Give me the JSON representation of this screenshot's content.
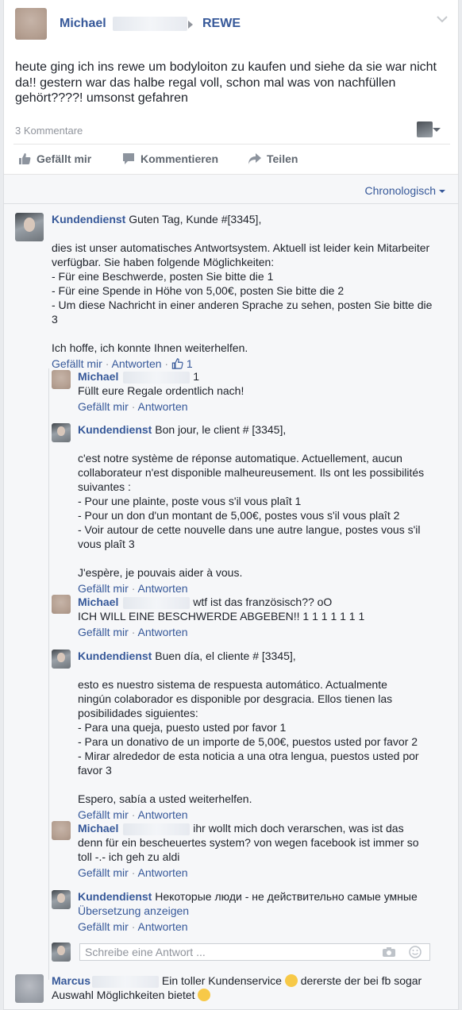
{
  "post": {
    "author": "Michael",
    "target": "REWE",
    "text": "heute ging ich ins rewe um bodyloiton zu kaufen und siehe da sie war nicht da!! gestern war das halbe regal voll, schon mal was von nachfüllen gehört????! umsonst gefahren",
    "comment_count": "3 Kommentare"
  },
  "actions": {
    "like": "Gefällt mir",
    "comment": "Kommentieren",
    "share": "Teilen"
  },
  "sort_label": "Chronologisch",
  "comments": [
    {
      "author": "Kundendienst",
      "lead": "Guten Tag, Kunde #[3345],",
      "lines": [
        "dies ist unser automatisches Antwortsystem. Aktuell ist leider kein Mitarbeiter",
        "verfügbar. Sie haben folgende Möglichkeiten:",
        "- Für eine Beschwerde, posten Sie bitte die 1",
        "- Für eine Spende in Höhe von 5,00€, posten Sie bitte die 2",
        "- Um diese Nachricht in einer anderen Sprache zu sehen, posten Sie bitte die",
        "3"
      ],
      "closing": "Ich hoffe, ich konnte Ihnen weiterhelfen.",
      "like": "Gefällt mir",
      "reply": "Antworten",
      "reactions": "1"
    }
  ],
  "replies": [
    {
      "author": "Michael",
      "suffix": "1",
      "lines": [
        "Füllt eure Regale ordentlich nach!"
      ],
      "like": "Gefällt mir",
      "reply": "Antworten"
    },
    {
      "author": "Kundendienst",
      "lead": "Bon jour, le client # [3345],",
      "lines": [
        "c'est notre système de réponse automatique. Actuellement, aucun",
        "collaborateur n'est disponible malheureusement. Ils ont les possibilités",
        "suivantes :",
        "- Pour une plainte, poste vous s'il vous plaît 1",
        "- Pour un don d'un montant de 5,00€, postes vous s'il vous plaît 2",
        "- Voir autour de cette nouvelle dans une autre langue, postes vous s'il",
        "vous plaît 3"
      ],
      "closing": "J'espère, je pouvais aider à vous.",
      "like": "Gefällt mir",
      "reply": "Antworten"
    },
    {
      "author": "Michael",
      "suffix": "wtf ist das französisch?? oO",
      "lines": [
        "ICH WILL EINE BESCHWERDE ABGEBEN!! 1 1 1 1 1 1 1"
      ],
      "like": "Gefällt mir",
      "reply": "Antworten"
    },
    {
      "author": "Kundendienst",
      "lead": "Buen día, el cliente # [3345],",
      "lines": [
        "esto es nuestro sistema de respuesta automático. Actualmente",
        "ningún colaborador es disponible por desgracia. Ellos tienen las",
        "posibilidades siguientes:",
        "- Para una queja, puesto usted por favor 1",
        "- Para un donativo de un importe de 5,00€, puestos usted por favor 2",
        "- Mirar alrededor de esta noticia a una otra lengua, puestos usted por",
        "favor 3"
      ],
      "closing": "Espero, sabía a usted weiterhelfen.",
      "like": "Gefällt mir",
      "reply": "Antworten"
    },
    {
      "author": "Michael",
      "suffix": "ihr wollt mich doch verarschen, was ist das",
      "lines": [
        "denn für ein bescheuertes system? von wegen facebook ist immer so",
        "toll -.- ich geh zu aldi"
      ],
      "like": "Gefällt mir",
      "reply": "Antworten"
    },
    {
      "author": "Kundendienst",
      "lead": "Некоторые люди - не действительно самые умные",
      "lines": [],
      "translate": "Übersetzung anzeigen",
      "like": "Gefällt mir",
      "reply": "Antworten"
    }
  ],
  "reply_placeholder": "Schreibe eine Antwort ...",
  "last_comment": {
    "author": "Marcus",
    "text1": "Ein toller Kundenservice",
    "text2": "dererste der bei fb sogar",
    "text3": "Auswahl Möglichkeiten bietet"
  },
  "colors": {
    "link": "#365899",
    "text": "#1d2129",
    "muted": "#90949c",
    "bg": "#f6f7f9"
  }
}
